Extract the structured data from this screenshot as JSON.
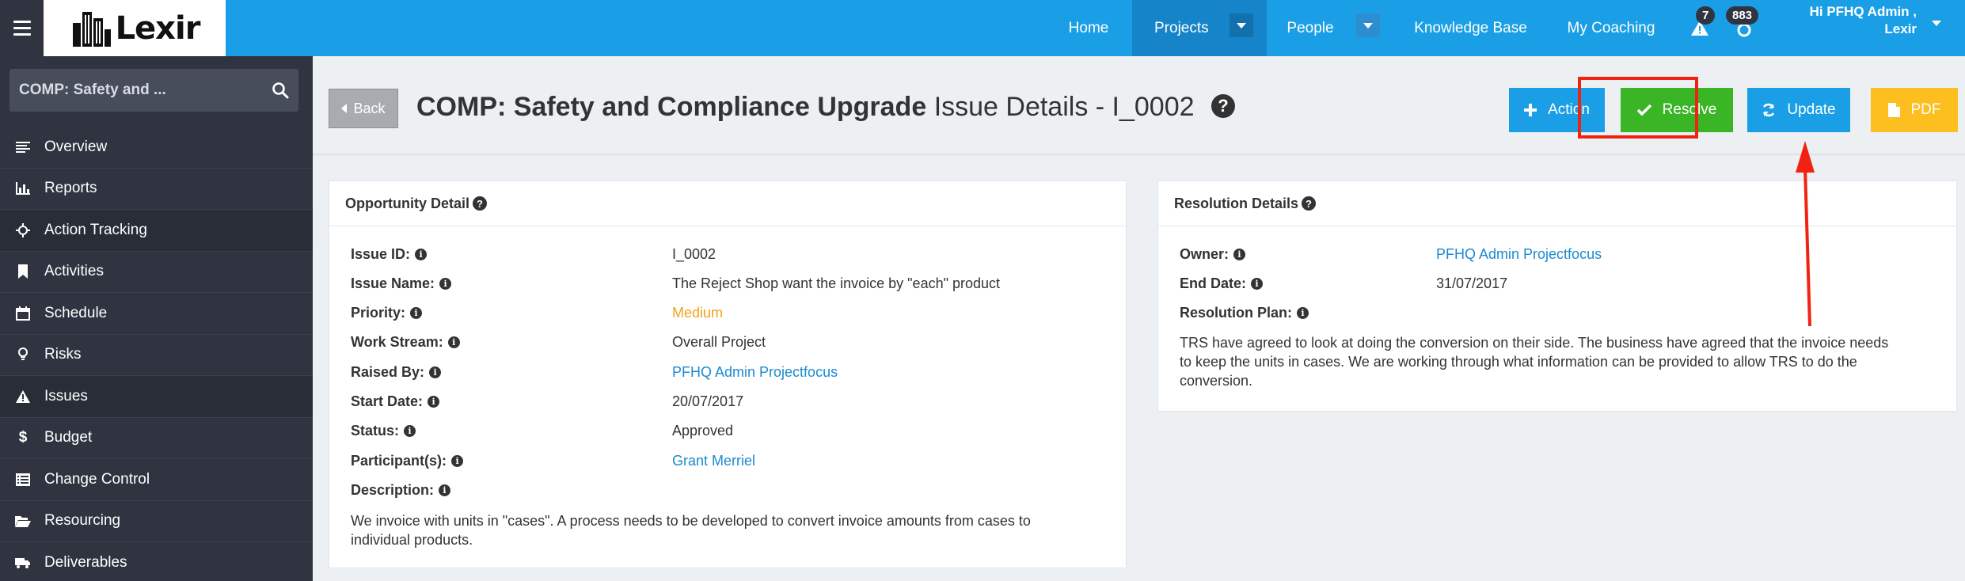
{
  "app": {
    "logo_text": "Lexir",
    "nav": [
      {
        "label": "Home"
      },
      {
        "label": "Projects"
      },
      {
        "label": "People"
      },
      {
        "label": "Knowledge Base"
      },
      {
        "label": "My Coaching"
      }
    ],
    "notifications": {
      "alerts_count": "7",
      "messages_count": "883"
    },
    "user_greeting_line1": "Hi PFHQ Admin ,",
    "user_greeting_line2": "Lexir"
  },
  "sidebar": {
    "search_value": "COMP: Safety and ...",
    "items": [
      {
        "label": "Overview",
        "icon": "list-icon"
      },
      {
        "label": "Reports",
        "icon": "bar-chart-icon"
      },
      {
        "label": "Action Tracking",
        "icon": "crosshairs-icon"
      },
      {
        "label": "Activities",
        "icon": "bookmark-icon"
      },
      {
        "label": "Schedule",
        "icon": "calendar-icon"
      },
      {
        "label": "Risks",
        "icon": "lightbulb-icon"
      },
      {
        "label": "Issues",
        "icon": "warning-icon"
      },
      {
        "label": "Budget",
        "icon": "dollar-icon"
      },
      {
        "label": "Change Control",
        "icon": "list-alt-icon"
      },
      {
        "label": "Resourcing",
        "icon": "folder-open-icon"
      },
      {
        "label": "Deliverables",
        "icon": "truck-icon"
      }
    ]
  },
  "header": {
    "back_label": "Back",
    "title_bold": "COMP: Safety and Compliance Upgrade",
    "title_rest": "Issue Details - I_0002",
    "help_symbol": "?",
    "buttons": {
      "action": "Action",
      "resolve": "Resolve",
      "update": "Update",
      "pdf": "PDF"
    }
  },
  "opportunity": {
    "title": "Opportunity Detail",
    "fields": [
      {
        "label": "Issue ID:",
        "value": "I_0002"
      },
      {
        "label": "Issue Name:",
        "value": "The Reject Shop want the invoice by \"each\" product"
      },
      {
        "label": "Priority:",
        "value": "Medium"
      },
      {
        "label": "Work Stream:",
        "value": "Overall Project"
      },
      {
        "label": "Raised By:",
        "value": "PFHQ Admin Projectfocus"
      },
      {
        "label": "Start Date:",
        "value": "20/07/2017"
      },
      {
        "label": "Status:",
        "value": "Approved"
      },
      {
        "label": "Participant(s):",
        "value": "Grant Merriel"
      }
    ],
    "description_label": "Description:",
    "description_line1": "We invoice with units in \"cases\". A process needs to be developed to convert invoice amounts from cases to",
    "description_line2": "individual products."
  },
  "resolution": {
    "title": "Resolution Details",
    "owner_label": "Owner:",
    "owner_value": "PFHQ Admin Projectfocus",
    "end_date_label": "End Date:",
    "end_date_value": "31/07/2017",
    "plan_label": "Resolution Plan:",
    "plan_line1": "TRS have agreed to look at doing the conversion on their side. The business have agreed that the invoice needs",
    "plan_line2": "to keep the units in cases. We are working through what information can be provided to allow TRS to do the",
    "plan_line3": "conversion."
  },
  "colors": {
    "topbar": "#1a9fe6",
    "sidebar": "#2f3440",
    "resolve_green": "#3ab526",
    "pdf_yellow": "#fcbf1f",
    "priority_orange": "#f0a31c",
    "annotation_red": "#f22213"
  }
}
